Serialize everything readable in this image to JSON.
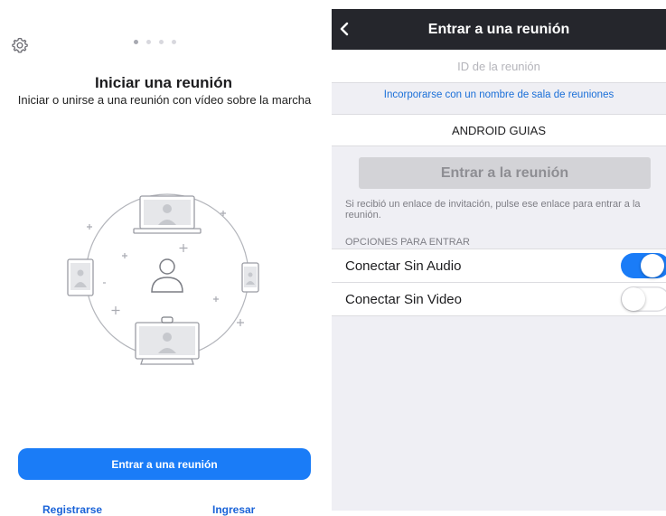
{
  "left": {
    "title": "Iniciar una reunión",
    "subtitle": "Iniciar o unirse a una reunión con vídeo sobre la marcha",
    "pager": {
      "count": 4,
      "active": 0
    },
    "join_button": "Entrar a una reunión",
    "signup_link": "Registrarse",
    "login_link": "Ingresar",
    "icons": [
      "gear-icon",
      "meeting-illustration"
    ]
  },
  "right": {
    "title": "Entrar a una reunión",
    "meeting_id_placeholder": "ID de la reunión",
    "personal_room_link": "Incorporarse con un nombre de sala de reuniones",
    "display_name": "ANDROID GUIAS",
    "enter_button": "Entrar a la reunión",
    "hint": "Si recibió un enlace de invitación, pulse ese enlace para entrar a la reunión.",
    "options_header": "OPCIONES PARA ENTRAR",
    "options": [
      {
        "label": "Conectar Sin Audio",
        "enabled": true
      },
      {
        "label": "Conectar Sin Video",
        "enabled": false
      }
    ]
  },
  "colors": {
    "accent": "#1a7cf7",
    "header_bg": "#25262c",
    "link": "#1a6fd8",
    "background": "#efeff4"
  }
}
